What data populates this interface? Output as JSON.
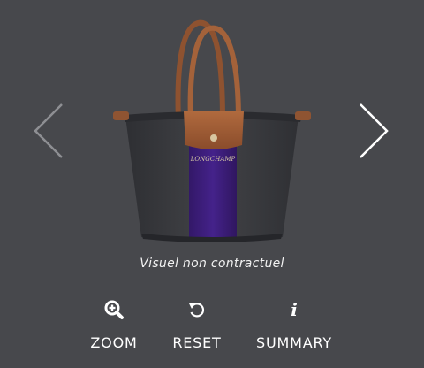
{
  "viewer": {
    "image_caption": "Visuel non contractuel",
    "product_logo_text": "LONGCHAMP",
    "nav": {
      "prev_icon": "chevron-left-icon",
      "next_icon": "chevron-right-icon"
    }
  },
  "toolbar": {
    "zoom": {
      "label": "ZOOM",
      "icon": "zoom-in-icon"
    },
    "reset": {
      "label": "RESET",
      "icon": "reset-icon"
    },
    "summary": {
      "label": "SUMMARY",
      "icon": "info-icon",
      "glyph": "i"
    }
  },
  "colors": {
    "background": "#47484c",
    "bag_body": "#3a3b3f",
    "bag_stripe": "#3d1f7a",
    "leather": "#9a5a35"
  }
}
